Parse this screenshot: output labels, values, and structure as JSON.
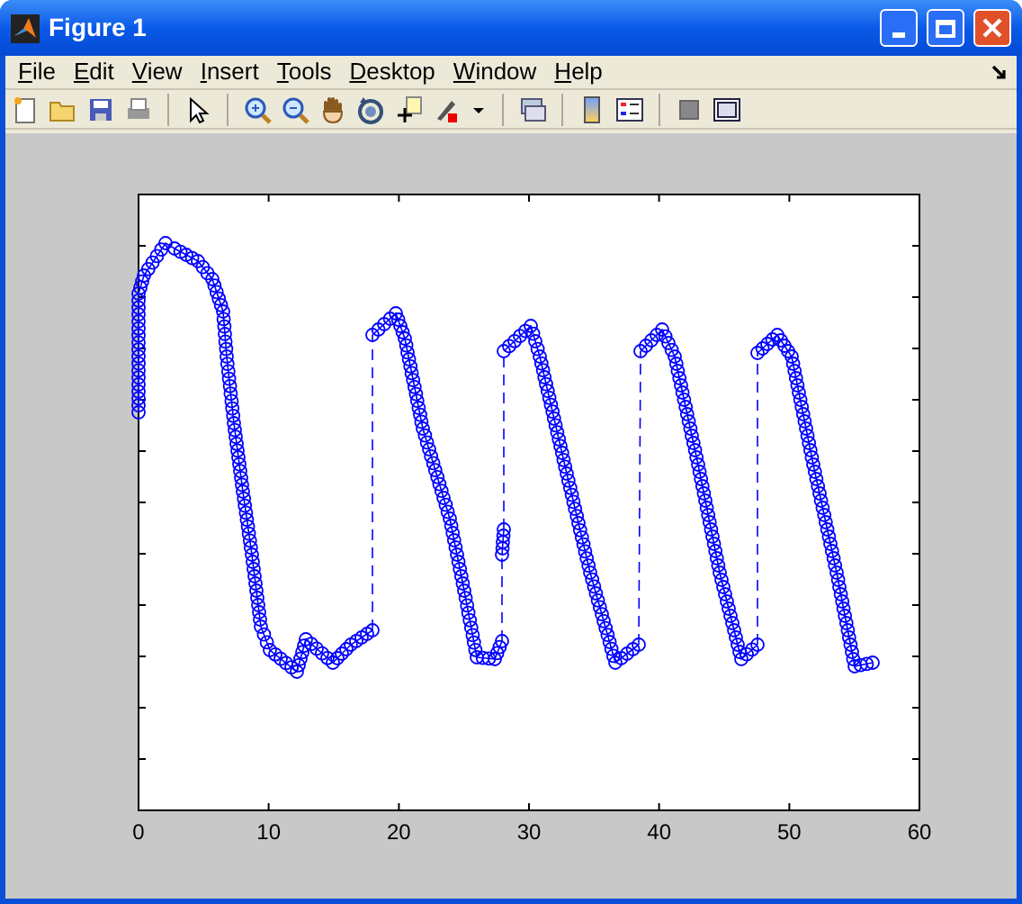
{
  "window": {
    "title": "Figure 1"
  },
  "menu": [
    "File",
    "Edit",
    "View",
    "Insert",
    "Tools",
    "Desktop",
    "Window",
    "Help"
  ],
  "axes": {
    "xtick_labels": [
      "0",
      "10",
      "20",
      "30",
      "40",
      "50",
      "60"
    ]
  }
}
